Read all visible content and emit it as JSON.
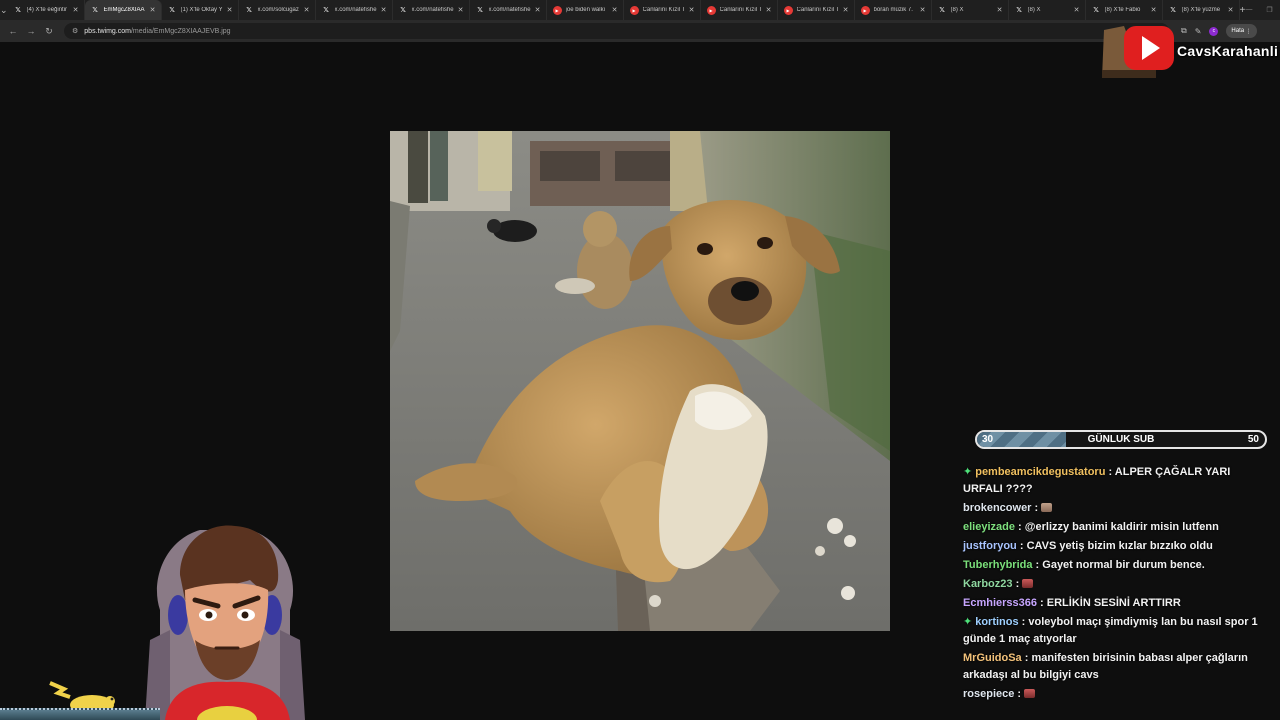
{
  "tabs": [
    {
      "label": "(4) X'te eeğintir",
      "icon": "x-icon",
      "active": false
    },
    {
      "label": "EmMgcZ8XIAA",
      "icon": "x-icon",
      "active": true
    },
    {
      "label": "(1) X'te Oktay Y",
      "icon": "x-icon",
      "active": false
    },
    {
      "label": "x.com/solcugaz",
      "icon": "x-icon",
      "active": false
    },
    {
      "label": "x.com/natefishe",
      "icon": "x-icon",
      "active": false
    },
    {
      "label": "x.com/natefishe",
      "icon": "x-icon",
      "active": false
    },
    {
      "label": "x.com/natefishe",
      "icon": "x-icon",
      "active": false
    },
    {
      "label": "joe biden walki",
      "icon": "youtube-icon",
      "active": false
    },
    {
      "label": "Canlarını Kızıl T",
      "icon": "youtube-icon",
      "active": false
    },
    {
      "label": "Canlarını Kızıl T",
      "icon": "youtube-icon",
      "active": false
    },
    {
      "label": "Canlarını Kızıl T",
      "icon": "youtube-icon",
      "active": false
    },
    {
      "label": "boran müzik 7.",
      "icon": "youtube-icon",
      "active": false
    },
    {
      "label": "(8) X",
      "icon": "x-icon",
      "active": false
    },
    {
      "label": "(8) X",
      "icon": "x-icon",
      "active": false
    },
    {
      "label": "(8) X'te Fabio",
      "icon": "x-icon",
      "active": false
    },
    {
      "label": "(8) X'te yüzme",
      "icon": "x-icon",
      "active": false
    }
  ],
  "address": {
    "host": "pbs.twimg.com",
    "path": "/media/EmMgcZ8XIAAJEVB.jpg"
  },
  "toolbar": {
    "error_label": "Hata",
    "extension_letter": "c"
  },
  "channel": {
    "name": "CavsKarahanli"
  },
  "goal": {
    "current": 30,
    "title": "GÜNLUK SUB",
    "target": 50,
    "current_label": "30",
    "target_label": "50",
    "fill_fraction": 0.31
  },
  "chat": [
    {
      "user": "pembeamcikdegustatoru",
      "text": "ALPER ÇAĞALR YARI URFALI ????",
      "color": "#f0c060",
      "badge": true,
      "emote": null
    },
    {
      "user": "brokencower",
      "text": "",
      "color": "#dfe6ee",
      "badge": false,
      "emote": "e1"
    },
    {
      "user": "elieyizade",
      "text": "@erlizzy banimi kaldirir misin lutfenn",
      "color": "#7ee07e",
      "badge": false,
      "emote": null
    },
    {
      "user": "justforyou",
      "text": "CAVS yetiş bizim kızlar bızzıko oldu",
      "color": "#a9c4ff",
      "badge": false,
      "emote": null
    },
    {
      "user": "Tuberhybrida",
      "text": "Gayet normal bir durum bence.",
      "color": "#7be07b",
      "badge": false,
      "emote": null
    },
    {
      "user": "Karboz23",
      "text": "",
      "color": "#8fd7a0",
      "badge": false,
      "emote": "e2"
    },
    {
      "user": "Ecmhierss366",
      "text": "ERLİKİN SESİNİ ARTTIRR",
      "color": "#c7a6ff",
      "badge": false,
      "emote": null
    },
    {
      "user": "kortinos",
      "text": "voleybol maçı şimdiymiş lan bu nasıl spor 1 günde 1 maç atıyorlar",
      "color": "#9fd0ff",
      "badge": true,
      "emote": null
    },
    {
      "user": "MrGuidoSa",
      "text": "manifesten birisinin babası alper çağların arkadaşı al bu bilgiyi cavs",
      "color": "#f3c27a",
      "badge": false,
      "emote": null
    },
    {
      "user": "rosepiece",
      "text": "",
      "color": "#dfe6ee",
      "badge": false,
      "emote": "e2"
    }
  ]
}
